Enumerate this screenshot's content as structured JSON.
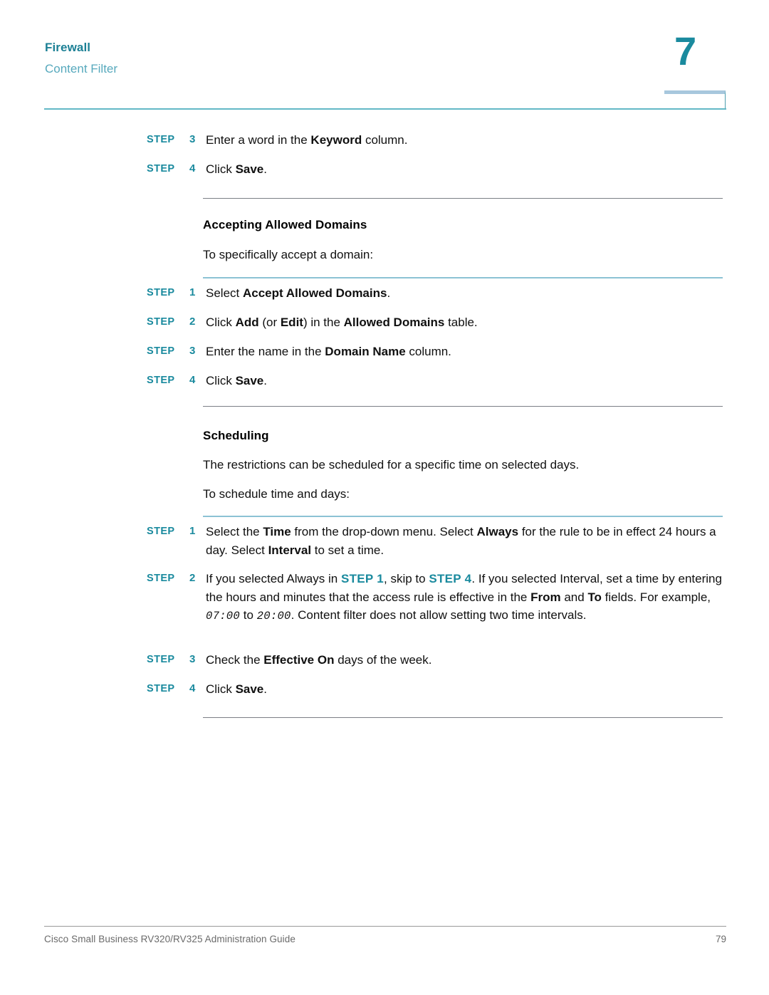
{
  "header": {
    "chapter_title": "Firewall",
    "section_title": "Content Filter",
    "chapter_number": "7",
    "accent_color": "#1a8a9e",
    "rule_color": "#63b8c6"
  },
  "blocks": {
    "step_label": "STEP",
    "keyword_step_3": {
      "number": "3",
      "text_parts": [
        {
          "t": "Enter a word in the ",
          "style": "normal"
        },
        {
          "t": "Keyword",
          "style": "bold"
        },
        {
          "t": " column.",
          "style": "normal"
        }
      ]
    },
    "keyword_step_4": {
      "number": "4",
      "text_parts": [
        {
          "t": "Click ",
          "style": "normal"
        },
        {
          "t": "Save",
          "style": "bold"
        },
        {
          "t": ".",
          "style": "normal"
        }
      ]
    },
    "accepting_heading": "Accepting Allowed Domains",
    "accepting_intro": "To specifically accept a domain:",
    "accepting_steps": [
      {
        "number": "1",
        "text_parts": [
          {
            "t": "Select ",
            "style": "normal"
          },
          {
            "t": "Accept Allowed Domains",
            "style": "bold"
          },
          {
            "t": ".",
            "style": "normal"
          }
        ]
      },
      {
        "number": "2",
        "text_parts": [
          {
            "t": "Click ",
            "style": "normal"
          },
          {
            "t": "Add",
            "style": "bold"
          },
          {
            "t": " (or ",
            "style": "normal"
          },
          {
            "t": "Edit",
            "style": "bold"
          },
          {
            "t": ") in the ",
            "style": "normal"
          },
          {
            "t": "Allowed Domains",
            "style": "bold"
          },
          {
            "t": " table.",
            "style": "normal"
          }
        ]
      },
      {
        "number": "3",
        "text_parts": [
          {
            "t": "Enter the name in the ",
            "style": "normal"
          },
          {
            "t": "Domain Name",
            "style": "bold"
          },
          {
            "t": " column.",
            "style": "normal"
          }
        ]
      },
      {
        "number": "4",
        "text_parts": [
          {
            "t": "Click ",
            "style": "normal"
          },
          {
            "t": "Save",
            "style": "bold"
          },
          {
            "t": ".",
            "style": "normal"
          }
        ]
      }
    ],
    "scheduling_heading": "Scheduling",
    "scheduling_intro_1": "The restrictions can be scheduled for a specific time on selected days.",
    "scheduling_intro_2": "To schedule time and days:",
    "scheduling_steps": [
      {
        "number": "1",
        "text_parts": [
          {
            "t": "Select the ",
            "style": "normal"
          },
          {
            "t": "Time",
            "style": "bold"
          },
          {
            "t": " from the drop-down menu. Select ",
            "style": "normal"
          },
          {
            "t": "Always",
            "style": "bold"
          },
          {
            "t": " for the rule to be in effect 24 hours a day. Select ",
            "style": "normal"
          },
          {
            "t": "Interval",
            "style": "bold"
          },
          {
            "t": " to set a time.",
            "style": "normal"
          }
        ]
      },
      {
        "number": "2",
        "text_parts": [
          {
            "t": "If you selected Always in ",
            "style": "normal"
          },
          {
            "t": "STEP 1",
            "style": "xref"
          },
          {
            "t": ", skip to ",
            "style": "normal"
          },
          {
            "t": "STEP 4",
            "style": "xref"
          },
          {
            "t": ". If you selected Interval, set a time by entering the hours and minutes that the access rule is effective in the ",
            "style": "normal"
          },
          {
            "t": "From",
            "style": "bold"
          },
          {
            "t": " and ",
            "style": "normal"
          },
          {
            "t": "To",
            "style": "bold"
          },
          {
            "t": " fields. For example, ",
            "style": "normal"
          },
          {
            "t": "07:00",
            "style": "mono"
          },
          {
            "t": " to ",
            "style": "normal"
          },
          {
            "t": "20:00",
            "style": "mono"
          },
          {
            "t": ". Content filter does not allow setting two time intervals.",
            "style": "normal"
          }
        ]
      },
      {
        "number": "3",
        "text_parts": [
          {
            "t": "Check the ",
            "style": "normal"
          },
          {
            "t": "Effective On",
            "style": "bold"
          },
          {
            "t": " days of the week.",
            "style": "normal"
          }
        ]
      },
      {
        "number": "4",
        "text_parts": [
          {
            "t": "Click ",
            "style": "normal"
          },
          {
            "t": "Save",
            "style": "bold"
          },
          {
            "t": ".",
            "style": "normal"
          }
        ]
      }
    ]
  },
  "footer": {
    "guide_title": "Cisco Small Business RV320/RV325 Administration Guide",
    "page_number": "79"
  }
}
